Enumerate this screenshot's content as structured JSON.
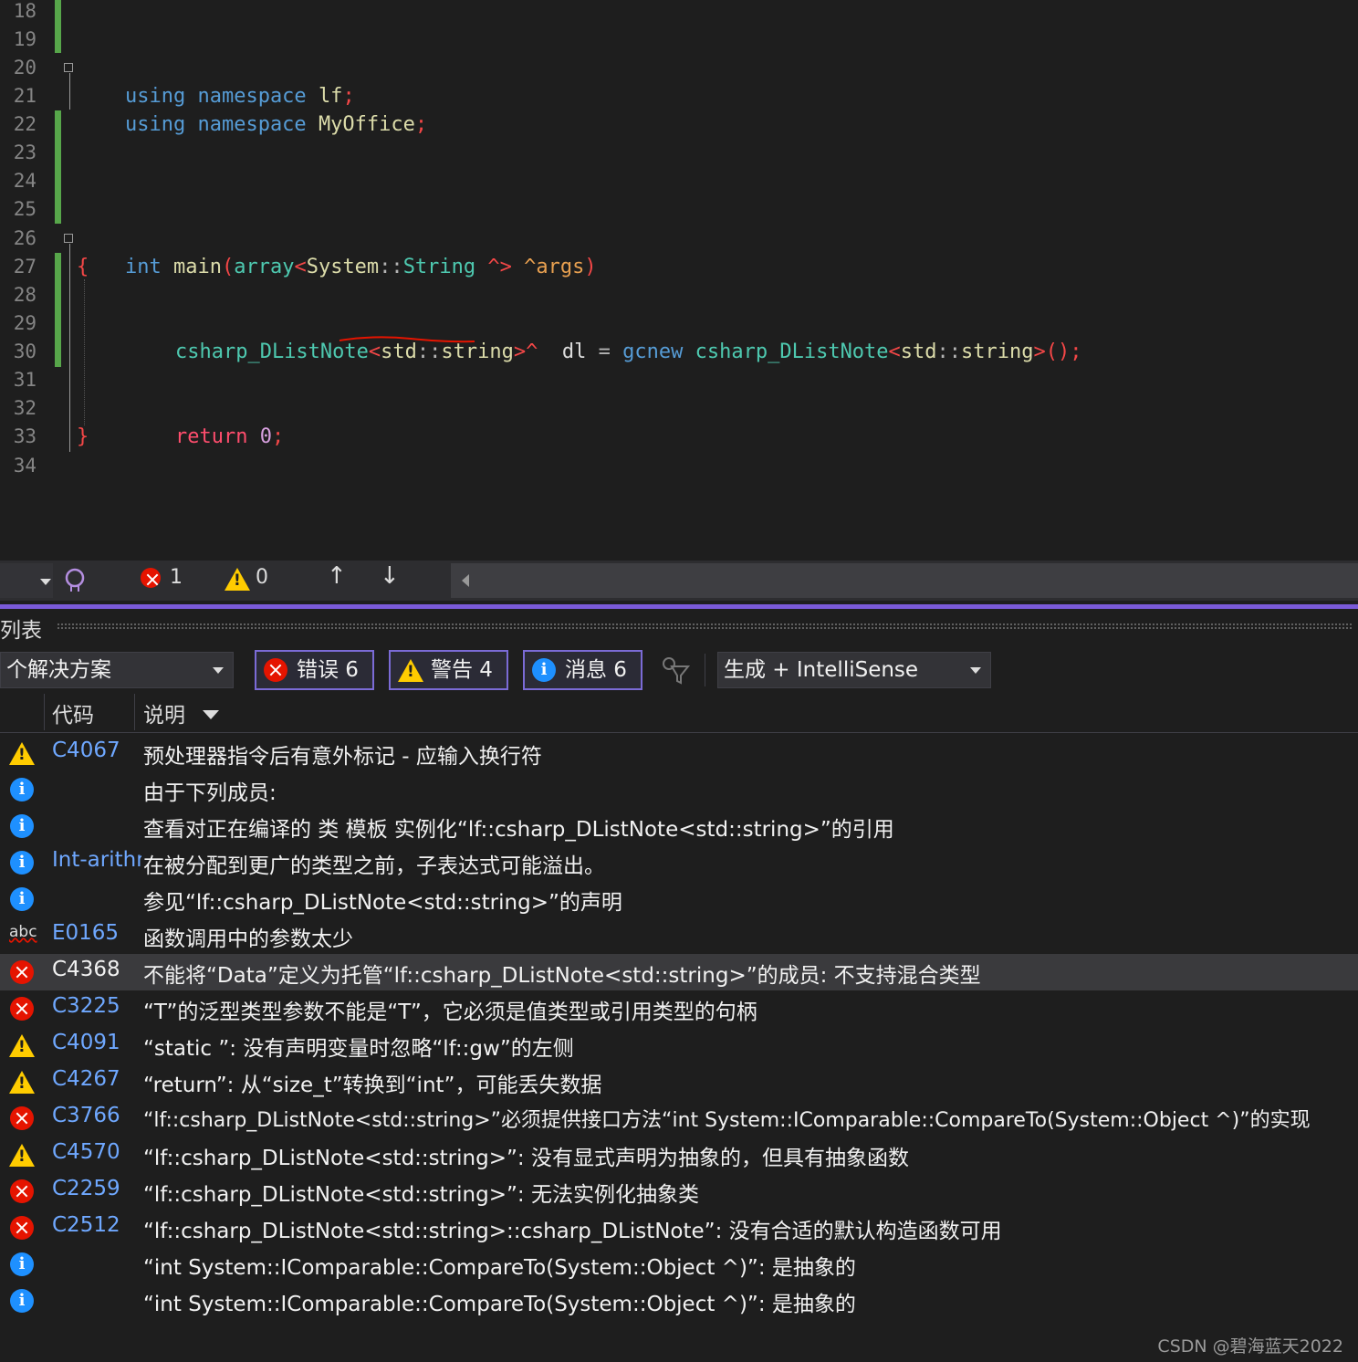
{
  "editor": {
    "line_numbers": [
      "18",
      "19",
      "20",
      "21",
      "22",
      "23",
      "24",
      "25",
      "26",
      "27",
      "28",
      "29",
      "30",
      "31",
      "32",
      "33",
      "34"
    ],
    "code": {
      "l20": {
        "kw1": "using",
        "kw2": "namespace",
        "name": "lf",
        "semi": ";"
      },
      "l21": {
        "kw1": "using",
        "kw2": "namespace",
        "name": "MyOffice",
        "semi": ";"
      },
      "l26": {
        "type": "int",
        "fn": "main",
        "p1": "(",
        "arr": "array",
        "lt": "<",
        "sys": "System",
        "cc": "::",
        "str": "String",
        "hat": " ^>",
        "arg": "^args",
        "p2": ")"
      },
      "l27": "{",
      "l29": {
        "cls": "csharp_DListNote",
        "lt": "<",
        "std": "std",
        "cc": "::",
        "s": "string",
        "gt": ">^",
        "var": "dl",
        "eq": "=",
        "gcnew": "gcnew",
        "cls2": "csharp_DListNote",
        "lt2": "<",
        "std2": "std",
        "cc2": "::",
        "s2": "string",
        "gt2": ">",
        "call": "();"
      },
      "l32": {
        "ret": "return",
        "num": "0",
        "semi": ";"
      },
      "l33": "}"
    }
  },
  "status_strip": {
    "errors": "1",
    "warnings": "0",
    "up": "↑",
    "down": "↓"
  },
  "panel": {
    "title": "列表",
    "scope": "个解决方案",
    "filters": {
      "errors": "错误 6",
      "warnings": "警告 4",
      "messages": "消息 6"
    },
    "build_source": "生成 + IntelliSense",
    "columns": {
      "code": "代码",
      "description": "说明"
    }
  },
  "rows": [
    {
      "icon": "warning",
      "code": "C4067",
      "desc": "预处理器指令后有意外标记 - 应输入换行符"
    },
    {
      "icon": "info",
      "code": "",
      "desc": "由于下列成员:"
    },
    {
      "icon": "info",
      "code": "",
      "desc": "查看对正在编译的 类 模板 实例化“lf::csharp_DListNote<std::string>”的引用"
    },
    {
      "icon": "info",
      "code": "Int-arithmetic",
      "desc": "在被分配到更广的类型之前，子表达式可能溢出。"
    },
    {
      "icon": "info",
      "code": "",
      "desc": "参见“lf::csharp_DListNote<std::string>”的声明"
    },
    {
      "icon": "abc",
      "code": "E0165",
      "desc": "函数调用中的参数太少"
    },
    {
      "icon": "error",
      "code": "C4368",
      "desc": "不能将“Data”定义为托管“lf::csharp_DListNote<std::string>”的成员: 不支持混合类型"
    },
    {
      "icon": "error",
      "code": "C3225",
      "desc": "“T”的泛型类型参数不能是“T”，它必须是值类型或引用类型的句柄"
    },
    {
      "icon": "warning",
      "code": "C4091",
      "desc": "“static ”: 没有声明变量时忽略“lf::gw”的左侧"
    },
    {
      "icon": "warning",
      "code": "C4267",
      "desc": "“return”: 从“size_t”转换到“int”，可能丢失数据"
    },
    {
      "icon": "error",
      "code": "C3766",
      "desc": "“lf::csharp_DListNote<std::string>”必须提供接口方法“int System::IComparable::CompareTo(System::Object ^)”的实现"
    },
    {
      "icon": "warning",
      "code": "C4570",
      "desc": "“lf::csharp_DListNote<std::string>”: 没有显式声明为抽象的，但具有抽象函数"
    },
    {
      "icon": "error",
      "code": "C2259",
      "desc": "“lf::csharp_DListNote<std::string>”: 无法实例化抽象类"
    },
    {
      "icon": "error",
      "code": "C2512",
      "desc": "“lf::csharp_DListNote<std::string>::csharp_DListNote”: 没有合适的默认构造函数可用"
    },
    {
      "icon": "info",
      "code": "",
      "desc": "“int System::IComparable::CompareTo(System::Object ^)”: 是抽象的"
    },
    {
      "icon": "info",
      "code": "",
      "desc": "“int System::IComparable::CompareTo(System::Object ^)”: 是抽象的"
    }
  ],
  "watermark": "CSDN @碧海蓝天2022",
  "colors": {
    "error": "#e51400",
    "warning": "#ffcc00",
    "info": "#1e90ff",
    "accent": "#7a5ad8",
    "gutter_change": "#57a64a"
  }
}
